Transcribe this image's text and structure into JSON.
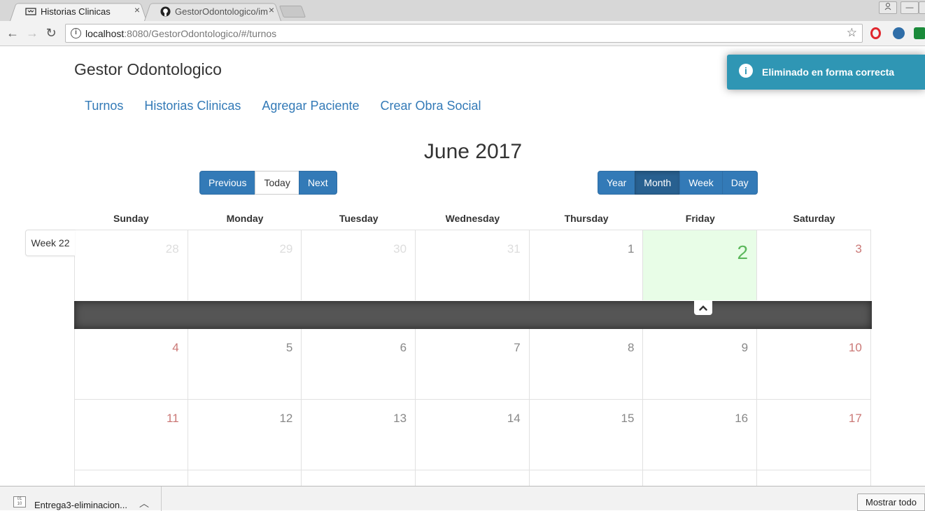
{
  "browser": {
    "tabs": [
      {
        "title": "Historias Clinicas",
        "close": "×",
        "active": true
      },
      {
        "title": "GestorOdontologico/im",
        "close": "×",
        "active": false
      }
    ],
    "url_host": "localhost",
    "url_rest": ":8080/GestorOdontologico/#/turnos"
  },
  "app": {
    "brand": "Gestor Odontologico",
    "nav": [
      "Turnos",
      "Historias Clinicas",
      "Agregar Paciente",
      "Crear Obra Social"
    ]
  },
  "calendar": {
    "title": "June 2017",
    "nav_buttons": {
      "previous": "Previous",
      "today": "Today",
      "next": "Next"
    },
    "view_buttons": {
      "year": "Year",
      "month": "Month",
      "week": "Week",
      "day": "Day",
      "active": "Month"
    },
    "weekdays": [
      "Sunday",
      "Monday",
      "Tuesday",
      "Wednesday",
      "Thursday",
      "Friday",
      "Saturday"
    ],
    "week_label": "Week 22",
    "today": "2",
    "rows": [
      [
        "28",
        "29",
        "30",
        "31",
        "1",
        "2",
        "3"
      ],
      [
        "4",
        "5",
        "6",
        "7",
        "8",
        "9",
        "10"
      ],
      [
        "11",
        "12",
        "13",
        "14",
        "15",
        "16",
        "17"
      ]
    ]
  },
  "toast": {
    "message": "Eliminado en forma correcta",
    "type": "info",
    "color": "#2f96b4"
  },
  "downloads": {
    "file_name": "Entrega3-eliminacion...",
    "icon_text": "01\n10",
    "show_all": "Mostrar todo"
  }
}
